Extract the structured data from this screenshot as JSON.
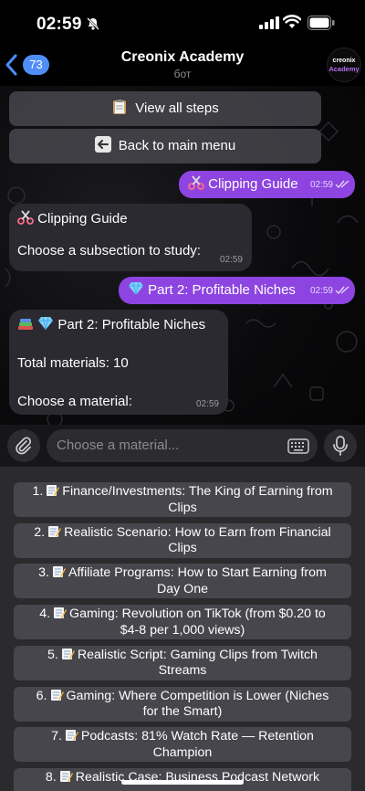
{
  "status_bar": {
    "time": "02:59"
  },
  "header": {
    "back_count": "73",
    "title": "Creonix Academy",
    "subtitle": "бот",
    "avatar_line1": "creonix",
    "avatar_line2": "Academy"
  },
  "chat": {
    "inline_buttons": [
      {
        "label": "View all steps",
        "icon": "clipboard-icon"
      },
      {
        "label": "Back to main menu",
        "icon": "back-arrow-icon"
      }
    ],
    "messages": [
      {
        "dir": "out",
        "text": "Clipping Guide",
        "icon": "scissors-icon",
        "time": "02:59"
      },
      {
        "dir": "in",
        "lines": [
          "Clipping Guide",
          "Choose a subsection to study:"
        ],
        "icon": "scissors-icon",
        "time": "02:59"
      },
      {
        "dir": "out",
        "text": "Part 2: Profitable Niches",
        "icon": "gem-icon",
        "time": "02:59"
      },
      {
        "dir": "in",
        "lines": [
          "Part 2: Profitable Niches",
          "Total materials: 10",
          "Choose a material:"
        ],
        "icons": [
          "books-icon",
          "gem-icon"
        ],
        "time": "02:59"
      }
    ]
  },
  "input": {
    "placeholder": "Choose a material..."
  },
  "reply_keyboard": [
    {
      "num": "1.",
      "line1": "Finance/Investments: The King of Earning from",
      "line2": "Clips"
    },
    {
      "num": "2.",
      "line1": "Realistic Scenario: How to Earn from Financial",
      "line2": "Clips"
    },
    {
      "num": "3.",
      "line1": "Affiliate Programs: How to Start Earning from",
      "line2": "Day One"
    },
    {
      "num": "4.",
      "line1": "Gaming: Revolution on TikTok (from $0.20 to",
      "line2": "$4-8 per 1,000 views)"
    },
    {
      "num": "5.",
      "line1": "Realistic Script: Gaming Clips from Twitch",
      "line2": "Streams"
    },
    {
      "num": "6.",
      "line1": "Gaming: Where Competition is Lower (Niches",
      "line2": "for the Smart)"
    },
    {
      "num": "7.",
      "line1": "Podcasts: 81% Watch Rate — Retention",
      "line2": "Champion"
    },
    {
      "num": "8.",
      "line1": "Realistic Case: Business Podcast Network",
      "line2": ""
    }
  ],
  "colors": {
    "accent": "#8d44e0",
    "badge": "#4f8ef7"
  }
}
